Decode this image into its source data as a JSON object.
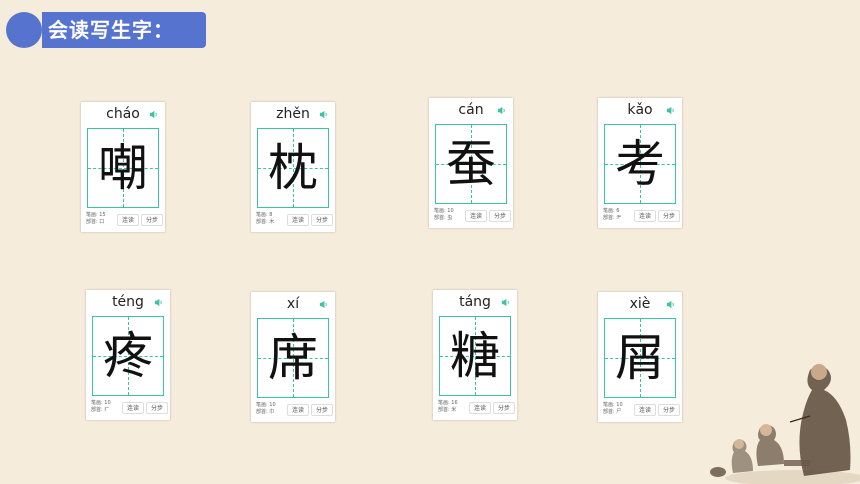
{
  "header": {
    "title": "会读写生字："
  },
  "labels": {
    "strokes": "笔画:",
    "radical": "部首:",
    "btn_lianxie": "连读",
    "btn_fenbu": "分步"
  },
  "cards": [
    {
      "pinyin": "cháo",
      "hanzi": "嘲",
      "strokes": "15",
      "radical": "口"
    },
    {
      "pinyin": "zhěn",
      "hanzi": "枕",
      "strokes": "8",
      "radical": "木"
    },
    {
      "pinyin": "cán",
      "hanzi": "蚕",
      "strokes": "10",
      "radical": "虫"
    },
    {
      "pinyin": "kǎo",
      "hanzi": "考",
      "strokes": "6",
      "radical": "耂"
    },
    {
      "pinyin": "téng",
      "hanzi": "疼",
      "strokes": "10",
      "radical": "疒"
    },
    {
      "pinyin": "xí",
      "hanzi": "席",
      "strokes": "10",
      "radical": "巾"
    },
    {
      "pinyin": "táng",
      "hanzi": "糖",
      "strokes": "16",
      "radical": "米"
    },
    {
      "pinyin": "xiè",
      "hanzi": "屑",
      "strokes": "10",
      "radical": "尸"
    }
  ],
  "colors": {
    "accent": "#5674cf",
    "grid": "#3ec2a4",
    "background": "#f6ecdc"
  },
  "icons": {
    "speaker": "speaker-icon"
  }
}
